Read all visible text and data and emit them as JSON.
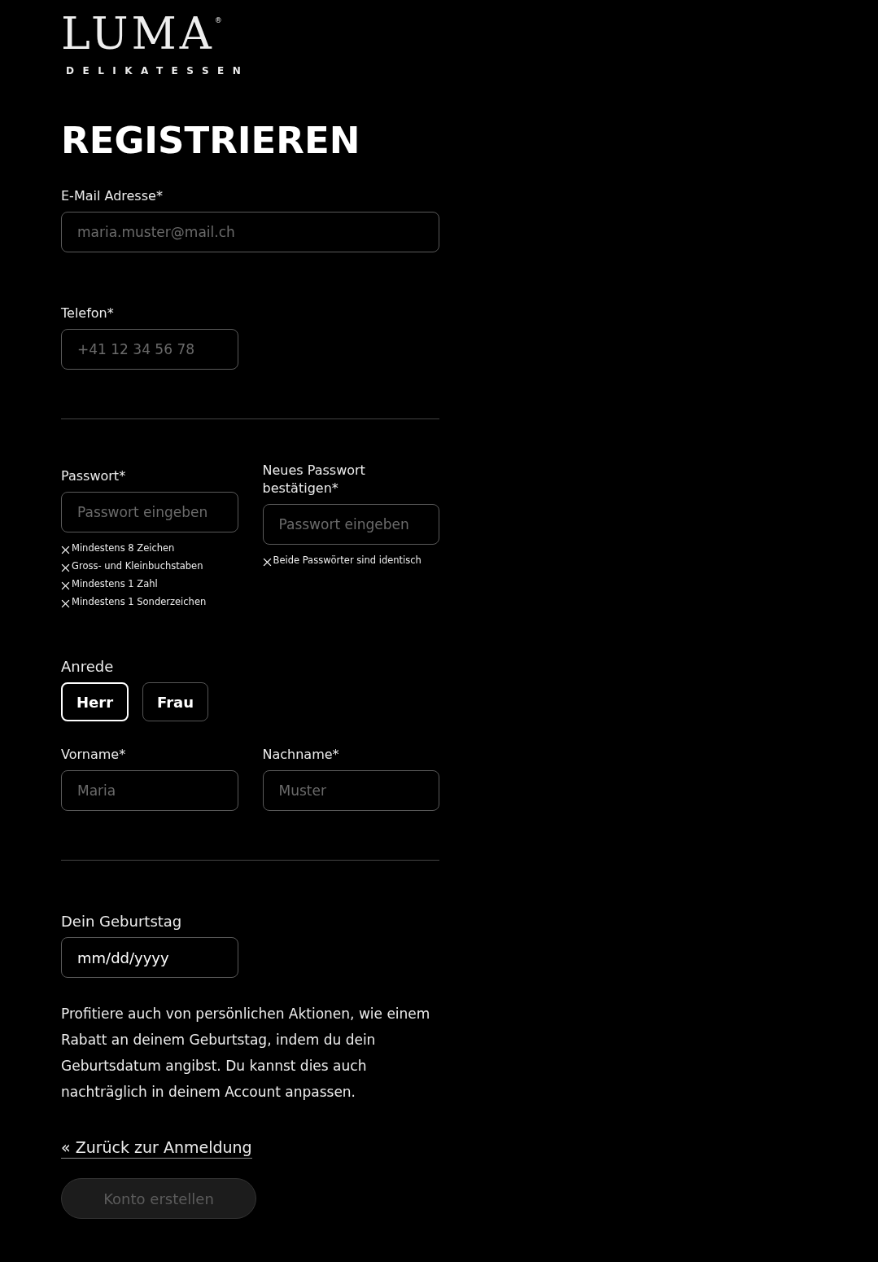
{
  "logo": {
    "wordmark": "LUMA",
    "registered": "®",
    "tagline": "DELIKATESSEN"
  },
  "title": "REGISTRIEREN",
  "email": {
    "label": "E-Mail Adresse*",
    "placeholder": "maria.muster@mail.ch"
  },
  "phone": {
    "label": "Telefon*",
    "placeholder": "+41 12 34 56 78"
  },
  "password": {
    "label": "Passwort*",
    "placeholder": "Passwort eingeben",
    "rules": [
      {
        "text": "Mindestens 8 Zeichen",
        "met": false
      },
      {
        "text": "Gross- und Kleinbuchstaben",
        "met": false
      },
      {
        "text": "Mindestens 1 Zahl",
        "met": false
      },
      {
        "text": "Mindestens 1 Sonderzeichen",
        "met": false
      }
    ]
  },
  "password_confirm": {
    "label": "Neues Passwort bestätigen*",
    "placeholder": "Passwort eingeben",
    "rules": [
      {
        "text": "Beide Passwörter sind identisch",
        "met": false
      }
    ]
  },
  "salutation": {
    "label": "Anrede",
    "options": [
      {
        "label": "Herr",
        "selected": true
      },
      {
        "label": "Frau",
        "selected": false
      }
    ]
  },
  "first_name": {
    "label": "Vorname*",
    "placeholder": "Maria"
  },
  "last_name": {
    "label": "Nachname*",
    "placeholder": "Muster"
  },
  "birthday": {
    "label": "Dein Geburtstag",
    "value": "mm/dd/yyyy"
  },
  "birthday_note": "Profitiere auch von persönlichen Aktionen, wie einem Rabatt an deinem Geburtstag, indem du dein Geburtsdatum angibst. Du kannst dies auch nachträglich in deinem Account anpassen.",
  "back_link": "« Zurück zur Anmeldung",
  "submit": {
    "label": "Konto erstellen",
    "disabled": true
  }
}
